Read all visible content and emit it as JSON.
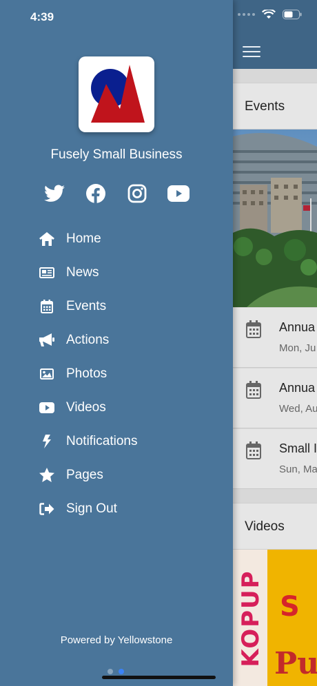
{
  "status_bar": {
    "time": "4:39"
  },
  "drawer": {
    "app_name": "Fusely Small Business",
    "social": [
      {
        "icon": "twitter-icon"
      },
      {
        "icon": "facebook-icon"
      },
      {
        "icon": "instagram-icon"
      },
      {
        "icon": "youtube-icon"
      }
    ],
    "menu": [
      {
        "label": "Home",
        "icon": "home-icon"
      },
      {
        "label": "News",
        "icon": "newspaper-icon"
      },
      {
        "label": "Events",
        "icon": "calendar-icon"
      },
      {
        "label": "Actions",
        "icon": "megaphone-icon"
      },
      {
        "label": "Photos",
        "icon": "image-icon"
      },
      {
        "label": "Videos",
        "icon": "video-icon"
      },
      {
        "label": "Notifications",
        "icon": "bolt-icon"
      },
      {
        "label": "Pages",
        "icon": "star-icon"
      },
      {
        "label": "Sign Out",
        "icon": "sign-out-icon"
      }
    ],
    "footer": "Powered by Yellowstone"
  },
  "background": {
    "events_title": "Events",
    "events": [
      {
        "title": "Annua",
        "date": "Mon, Ju"
      },
      {
        "title": "Annua",
        "date": "Wed, Au"
      },
      {
        "title": "Small I",
        "date": "Sun, Ma"
      }
    ],
    "videos_title": "Videos",
    "video_thumb_text": "KOPUP"
  },
  "colors": {
    "drawer": "#4a759a",
    "topbar": "#3f6586",
    "accent": "#3b82f6",
    "logo_red": "#c0141c",
    "logo_blue": "#0a1f8f"
  }
}
